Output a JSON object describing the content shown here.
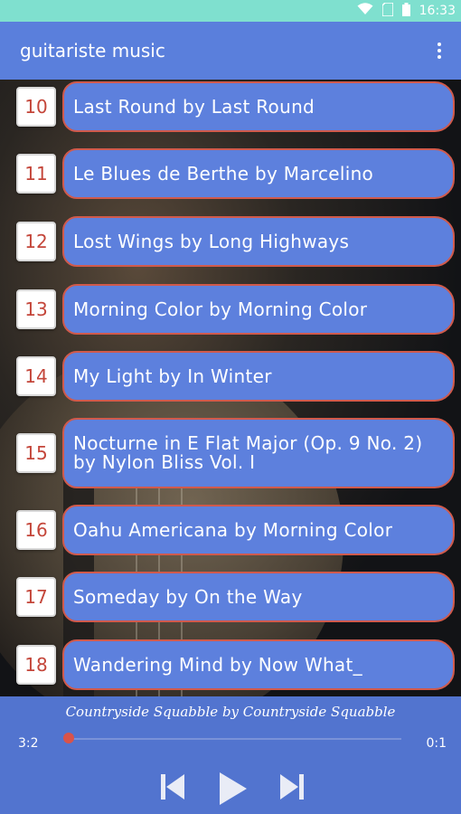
{
  "status_bar": {
    "time": "16:33",
    "icons": [
      "wifi-icon",
      "sim-icon",
      "battery-icon"
    ]
  },
  "app_bar": {
    "title": "guitariste music",
    "menu_icon": "overflow-menu-icon"
  },
  "songs": [
    {
      "number": "10",
      "title": "Last Round by Last Round"
    },
    {
      "number": "11",
      "title": "Le Blues de Berthe by Marcelino"
    },
    {
      "number": "12",
      "title": "Lost Wings by Long Highways"
    },
    {
      "number": "13",
      "title": "Morning Color by Morning Color"
    },
    {
      "number": "14",
      "title": "My Light by In Winter"
    },
    {
      "number": "15",
      "title": "Nocturne in E Flat Major (Op. 9 No. 2) by Nylon Bliss Vol. I"
    },
    {
      "number": "16",
      "title": "Oahu Americana by Morning Color"
    },
    {
      "number": "17",
      "title": "Someday by On the Way"
    },
    {
      "number": "18",
      "title": "Wandering Mind by Now What_"
    }
  ],
  "player": {
    "now_playing": "Countryside Squabble by Countryside Squabble",
    "elapsed": "3:2",
    "duration": "0:1",
    "progress": 0.0,
    "controls": [
      "skip-previous-icon",
      "play-icon",
      "skip-next-icon"
    ]
  },
  "colors": {
    "status_bar": "#7fe0cf",
    "app_bar": "#5a7fdc",
    "song_pill": "#5d80dd",
    "pill_border": "#d05a4c",
    "number_text": "#c4463a",
    "player": "#5274cf",
    "seek_thumb": "#d9534a"
  }
}
